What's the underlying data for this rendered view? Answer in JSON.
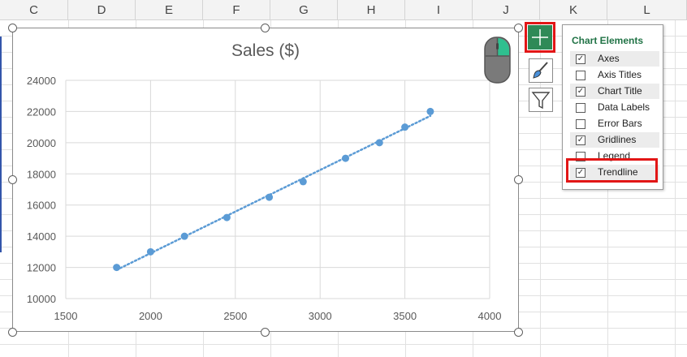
{
  "columns": [
    "C",
    "D",
    "E",
    "F",
    "G",
    "H",
    "I",
    "J",
    "K",
    "L"
  ],
  "chart": {
    "title": "Sales ($)"
  },
  "chart_data": {
    "type": "scatter",
    "title": "Sales ($)",
    "xlabel": "",
    "ylabel": "",
    "xlim": [
      1500,
      4000
    ],
    "ylim": [
      10000,
      24000
    ],
    "x_ticks": [
      "1500",
      "2000",
      "2500",
      "3000",
      "3500",
      "4000"
    ],
    "y_ticks": [
      "10000",
      "12000",
      "14000",
      "16000",
      "18000",
      "20000",
      "22000",
      "24000"
    ],
    "grid": true,
    "trendline": "linear (dotted)",
    "series": [
      {
        "x": [
          1800,
          2000,
          2200,
          2450,
          2700,
          2900,
          3150,
          3350,
          3500,
          3650
        ],
        "y": [
          12000,
          13000,
          14000,
          15200,
          16500,
          17500,
          19000,
          20000,
          21000,
          22000
        ]
      }
    ],
    "colors": {
      "points": "#5b9bd5",
      "trendline": "#5b9bd5"
    }
  },
  "chart_elements_panel": {
    "title": "Chart Elements",
    "items": [
      {
        "label": "Axes",
        "checked": true
      },
      {
        "label": "Axis Titles",
        "checked": false
      },
      {
        "label": "Chart Title",
        "checked": true
      },
      {
        "label": "Data Labels",
        "checked": false
      },
      {
        "label": "Error Bars",
        "checked": false
      },
      {
        "label": "Gridlines",
        "checked": true
      },
      {
        "label": "Legend",
        "checked": false
      },
      {
        "label": "Trendline",
        "checked": true
      }
    ]
  },
  "icons": {
    "plus_button": "plus-icon",
    "styles_button": "paintbrush-icon",
    "filter_button": "funnel-icon",
    "mouse": "mouse-icon"
  },
  "colors": {
    "accent_green": "#2f8a57",
    "highlight_red": "#e21616",
    "panel_title_green": "#217346"
  }
}
